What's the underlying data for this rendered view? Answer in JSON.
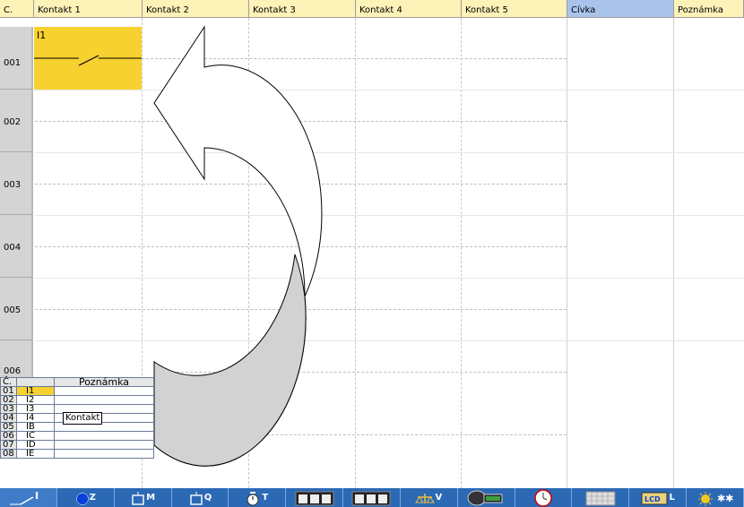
{
  "ladder": {
    "column_header_number": "C.",
    "columns": [
      "Kontakt 1",
      "Kontakt 2",
      "Kontakt 3",
      "Kontakt 4",
      "Kontakt 5",
      "Cívka",
      "Poznámka"
    ],
    "rows": [
      "001",
      "002",
      "003",
      "004",
      "005",
      "006"
    ],
    "cell_r1c1_label": "I1"
  },
  "io_panel": {
    "header_number": "Č.",
    "header_address": "",
    "header_note": "Poznámka",
    "rows": [
      {
        "num": "01",
        "addr": "I1",
        "selected": true
      },
      {
        "num": "02",
        "addr": "I2"
      },
      {
        "num": "03",
        "addr": "I3"
      },
      {
        "num": "04",
        "addr": "I4"
      },
      {
        "num": "05",
        "addr": "IB"
      },
      {
        "num": "06",
        "addr": "IC"
      },
      {
        "num": "07",
        "addr": "ID"
      },
      {
        "num": "08",
        "addr": "IE"
      }
    ],
    "tooltip": "Kontakt"
  },
  "colors": {
    "header_bg": "#fdf2b8",
    "coil_header_bg": "#aac3eb",
    "selected_cell": "#f7d130",
    "toolbar_bg": "#2b69b5"
  },
  "toolbar": {
    "items": [
      {
        "icon": "contact-icon",
        "letter": "I"
      },
      {
        "icon": "blue-circle-icon",
        "letter": "Z"
      },
      {
        "icon": "coil-box-icon",
        "letter": "M"
      },
      {
        "icon": "output-box-icon",
        "letter": "Q"
      },
      {
        "icon": "timer-icon",
        "letter": "T"
      },
      {
        "icon": "counter-icon",
        "letter": ""
      },
      {
        "icon": "counter-icon-2",
        "letter": ""
      },
      {
        "icon": "comparator-icon",
        "letter": "V"
      },
      {
        "icon": "analog-display-icon",
        "letter": ""
      },
      {
        "icon": "clock-icon",
        "letter": ""
      },
      {
        "icon": "grid-icon",
        "letter": ""
      },
      {
        "icon": "lcd-icon",
        "letter": "L"
      },
      {
        "icon": "sun-snow-icon",
        "letter": ""
      }
    ]
  }
}
